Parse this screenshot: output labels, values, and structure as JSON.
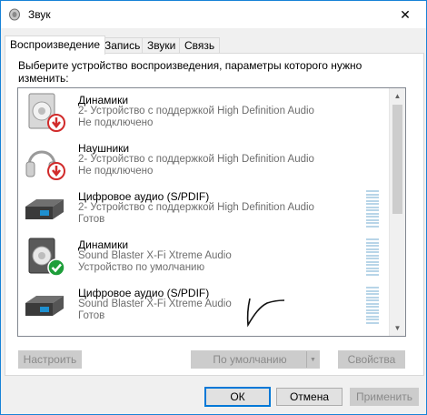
{
  "window": {
    "title": "Звук",
    "close_glyph": "✕"
  },
  "tabs": [
    {
      "label": "Воспроизведение",
      "active": true
    },
    {
      "label": "Запись",
      "active": false
    },
    {
      "label": "Звуки",
      "active": false
    },
    {
      "label": "Связь",
      "active": false
    }
  ],
  "prompt": "Выберите устройство воспроизведения, параметры которого нужно изменить:",
  "devices": [
    {
      "name": "Динамики",
      "desc": "2- Устройство с поддержкой High Definition Audio",
      "status": "Не подключено",
      "icon": "speaker-icon",
      "badge": "disconnected-badge-icon",
      "meter": false
    },
    {
      "name": "Наушники",
      "desc": "2- Устройство с поддержкой High Definition Audio",
      "status": "Не подключено",
      "icon": "headphones-icon",
      "badge": "disconnected-badge-icon",
      "meter": false
    },
    {
      "name": "Цифровое аудио (S/PDIF)",
      "desc": "2- Устройство с поддержкой High Definition Audio",
      "status": "Готов",
      "icon": "digital-audio-icon",
      "badge": "",
      "meter": true
    },
    {
      "name": "Динамики",
      "desc": "Sound Blaster X-Fi Xtreme Audio",
      "status": "Устройство по умолчанию",
      "icon": "speaker-icon",
      "badge": "default-check-badge-icon",
      "meter": true
    },
    {
      "name": "Цифровое аудио (S/PDIF)",
      "desc": "Sound Blaster X-Fi Xtreme Audio",
      "status": "Готов",
      "icon": "digital-audio-icon",
      "badge": "",
      "meter": true
    }
  ],
  "buttons": {
    "configure": "Настроить",
    "set_default": "По умолчанию",
    "properties": "Свойства",
    "ok": "ОК",
    "cancel": "Отмена",
    "apply": "Применить"
  },
  "colors": {
    "accent": "#0078d7",
    "disconnected": "#d12b2b",
    "default_ok": "#1e9e3a",
    "meter": "#b8d5e8"
  }
}
